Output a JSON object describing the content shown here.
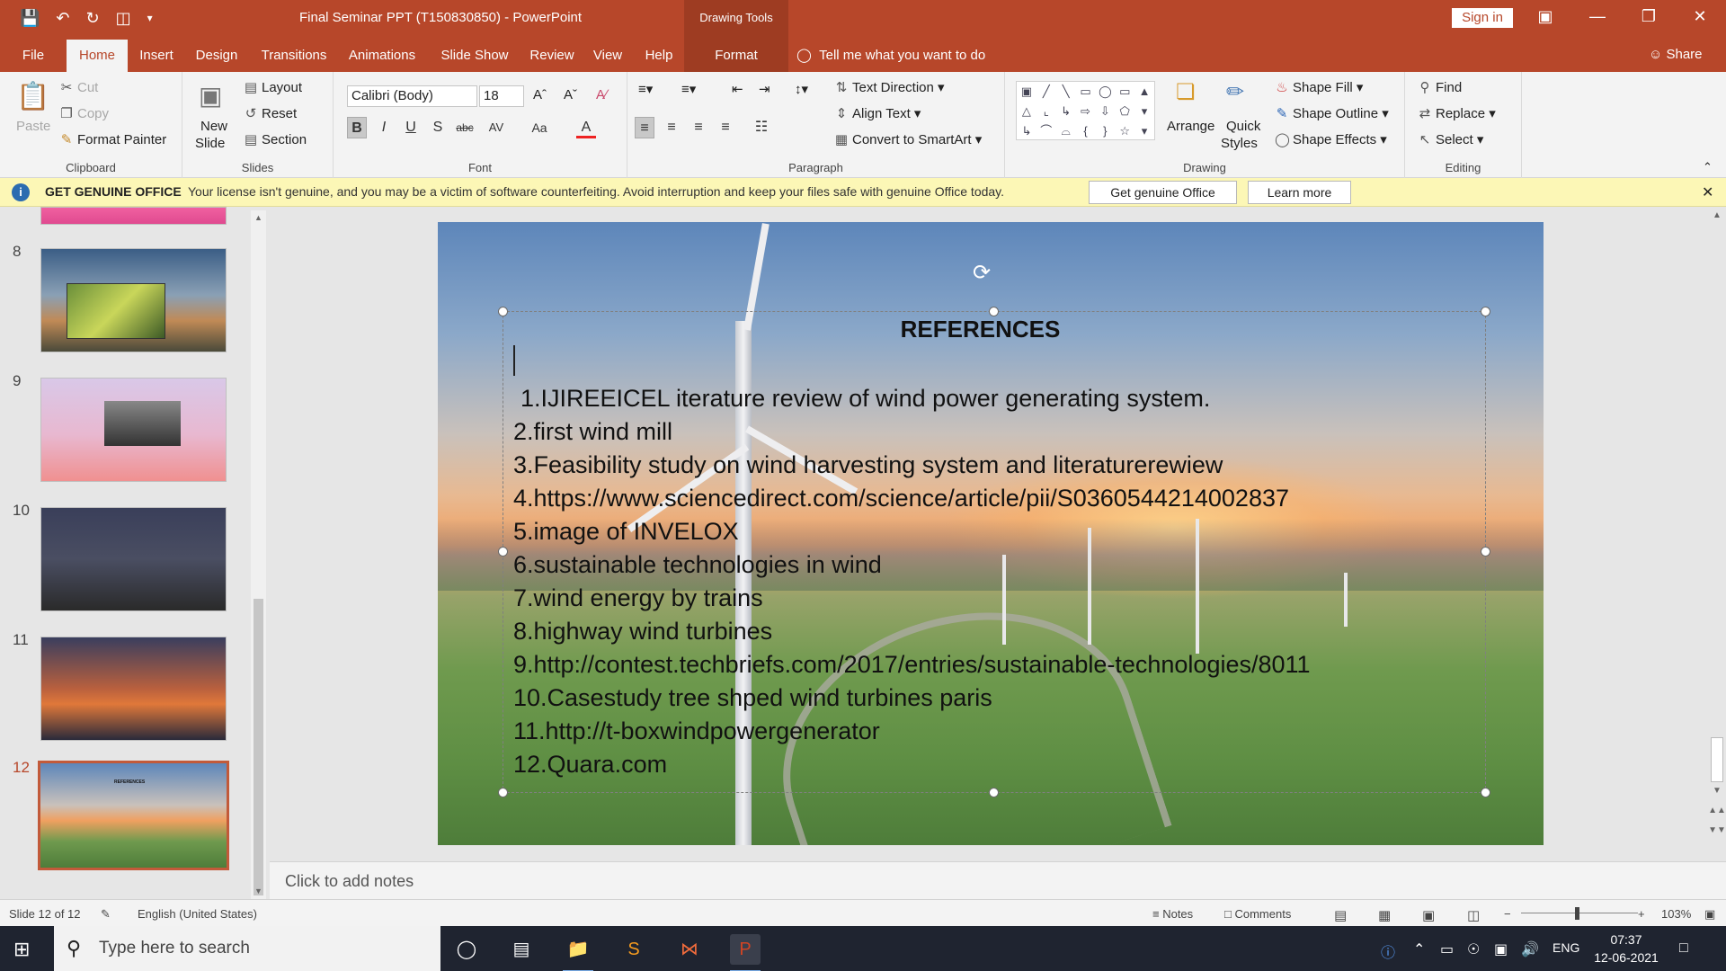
{
  "app": {
    "doc_title": "Final Seminar PPT (T150830850)  -  PowerPoint",
    "context_tab_group": "Drawing Tools",
    "signin_label": "Sign in"
  },
  "tabs": [
    "File",
    "Home",
    "Insert",
    "Design",
    "Transitions",
    "Animations",
    "Slide Show",
    "Review",
    "View",
    "Help",
    "Format"
  ],
  "active_tab": "Home",
  "tell_me": "Tell me what you want to do",
  "share_label": "Share",
  "ribbon": {
    "clipboard": {
      "label": "Clipboard",
      "paste": "Paste",
      "cut": "Cut",
      "copy": "Copy",
      "format_painter": "Format Painter"
    },
    "slides": {
      "label": "Slides",
      "new_slide_1": "New",
      "new_slide_2": "Slide",
      "layout": "Layout",
      "reset": "Reset",
      "section": "Section"
    },
    "font": {
      "label": "Font",
      "family": "Calibri (Body)",
      "size": "18"
    },
    "paragraph": {
      "label": "Paragraph",
      "text_direction": "Text Direction",
      "align_text": "Align Text",
      "convert_smartart": "Convert to SmartArt"
    },
    "drawing": {
      "label": "Drawing",
      "arrange": "Arrange",
      "quick_styles_1": "Quick",
      "quick_styles_2": "Styles",
      "shape_fill": "Shape Fill",
      "shape_outline": "Shape Outline",
      "shape_effects": "Shape Effects"
    },
    "editing": {
      "label": "Editing",
      "find": "Find",
      "replace": "Replace",
      "select": "Select"
    }
  },
  "license_bar": {
    "heading": "GET GENUINE OFFICE",
    "message": "Your license isn't genuine, and you may be a victim of software counterfeiting. Avoid interruption and keep your files safe with genuine Office today.",
    "btn_genuine": "Get genuine Office",
    "btn_learn": "Learn more"
  },
  "thumbnails": [
    {
      "num": "8",
      "selected": false
    },
    {
      "num": "9",
      "selected": false
    },
    {
      "num": "10",
      "selected": false
    },
    {
      "num": "11",
      "selected": false
    },
    {
      "num": "12",
      "selected": true
    }
  ],
  "slide": {
    "title": "REFERENCES",
    "references": [
      "1.IJIREEICEL iterature review of wind power generating system.",
      "2.first wind mill",
      "3.Feasibility study on wind harvesting system and literaturerewiew",
      "4.https://www.sciencedirect.com/science/article/pii/S0360544214002837",
      "5.image of INVELOX",
      "6.sustainable technologies in wind",
      "7.wind energy by trains",
      "8.highway wind turbines",
      "9.http://contest.techbriefs.com/2017/entries/sustainable-technologies/8011",
      "10.Casestudy tree shped wind turbines paris",
      "11.http://t-boxwindpowergenerator",
      "12.Quara.com"
    ]
  },
  "notes_placeholder": "Click to add notes",
  "status": {
    "slide_counter": "Slide 12 of 12",
    "language": "English (United States)",
    "notes": "Notes",
    "comments": "Comments",
    "zoom": "103%"
  },
  "taskbar": {
    "search_placeholder": "Type here to search",
    "lang": "ENG",
    "time": "07:37",
    "date": "12-06-2021"
  },
  "colors": {
    "accent": "#b7472a",
    "license_bar": "#fcf7b6"
  }
}
